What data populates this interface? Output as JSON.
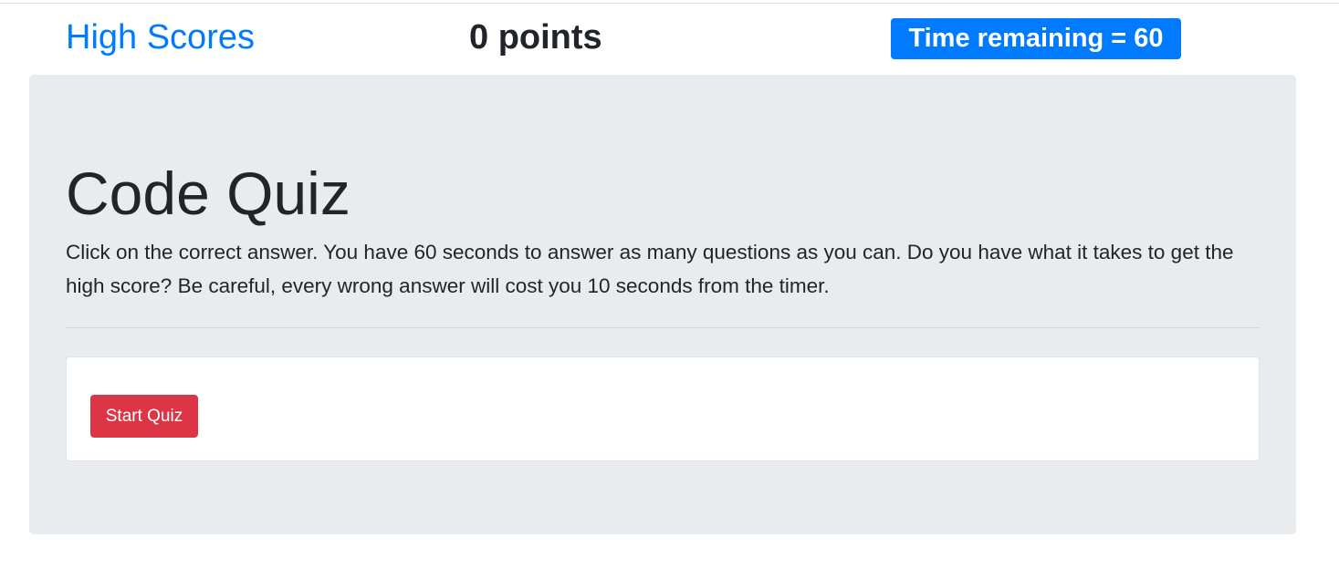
{
  "header": {
    "high_scores_label": "High Scores",
    "points_label": "0 points",
    "timer_label": "Time remaining = 60"
  },
  "jumbotron": {
    "title": "Code Quiz",
    "lead": "Click on the correct answer. You have 60 seconds to answer as many questions as you can. Do you have what it takes to get the high score? Be careful, every wrong answer will cost you 10 seconds from the timer."
  },
  "card": {
    "start_button_label": "Start Quiz"
  },
  "colors": {
    "link_blue": "#007bff",
    "badge_blue": "#007bff",
    "jumbotron_bg": "#e9ecef",
    "button_red": "#dc3545",
    "text_dark": "#212529"
  }
}
